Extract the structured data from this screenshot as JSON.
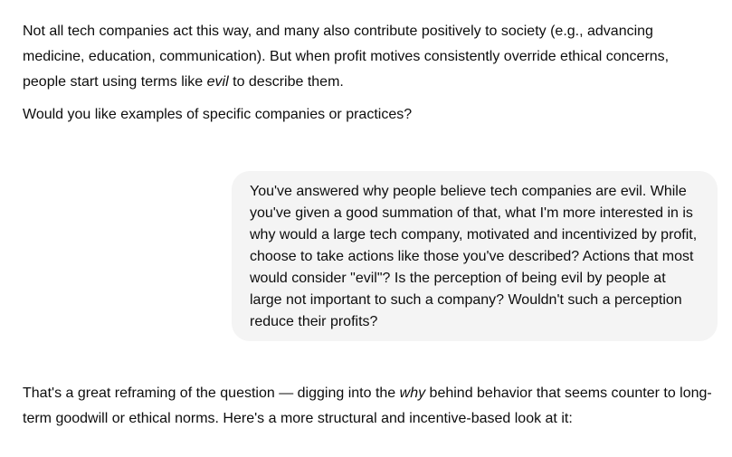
{
  "conversation": {
    "assistant_prev": {
      "p1": {
        "a": "Not all tech companies act this way, and many also contribute positively to society (e.g., advancing medicine, education, communication). But when profit motives consistently override ethical concerns, people start using terms like ",
        "em": "evil",
        "b": " to describe them."
      },
      "p2": "Would you like examples of specific companies or practices?"
    },
    "user_message": "You've answered why people believe tech companies are evil. While you've given a good summation of that, what I'm more interested in is why would a large tech company, motivated and incentivized by profit, choose to take actions like those you've described? Actions that most would consider \"evil\"? Is the perception of being evil by people at large not important to such a company? Wouldn't such a perception reduce their profits?",
    "assistant_reply": {
      "a": "That's a great reframing of the question — digging into the ",
      "em": "why",
      "b": " behind behavior that seems counter to long-term goodwill or ethical norms. Here's a more structural and incentive-based look at it:"
    }
  }
}
